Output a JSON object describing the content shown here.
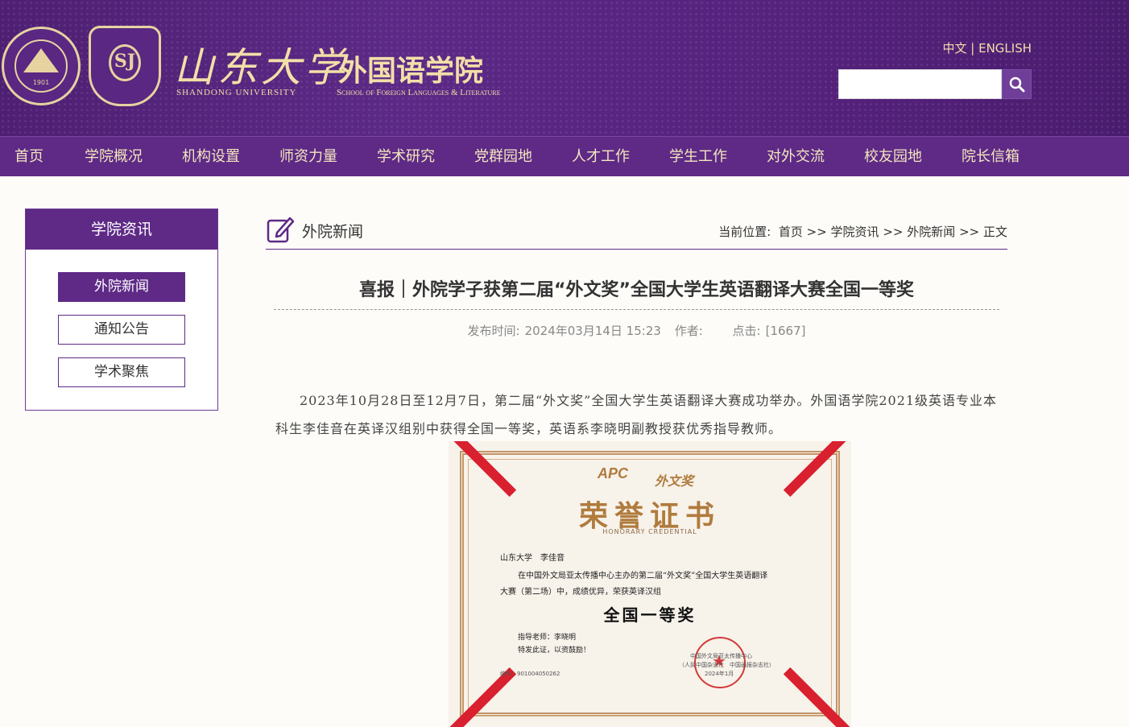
{
  "header": {
    "university_cn": "山东大学",
    "university_en": "SHANDONG UNIVERSITY",
    "school_cn": "外国语学院",
    "school_en": "School of Foreign Languages & Literature",
    "logo1_year": "1901",
    "logo2_text": "SJ",
    "lang_cn": "中文",
    "lang_sep": " | ",
    "lang_en": "ENGLISH",
    "search_placeholder": "",
    "search_icon": "search-icon",
    "accent_color": "#5e2a86",
    "gold_color": "#f2dfa8"
  },
  "nav": {
    "items": [
      "首页",
      "学院概况",
      "机构设置",
      "师资力量",
      "学术研究",
      "党群园地",
      "人才工作",
      "学生工作",
      "对外交流",
      "校友园地",
      "院长信箱"
    ]
  },
  "sidebar": {
    "title": "学院资讯",
    "items": [
      "外院新闻",
      "通知公告",
      "学术聚焦"
    ],
    "active_index": 0
  },
  "main": {
    "section_title": "外院新闻",
    "section_icon": "edit-icon",
    "crumb_prefix": "当前位置:",
    "crumbs": [
      "首页",
      "学院资讯",
      "外院新闻",
      "正文"
    ],
    "crumb_sep": ">>",
    "article_title": "喜报｜外院学子获第二届“外文奖”全国大学生英语翻译大赛全国一等奖",
    "publish_label": "发布时间:",
    "publish_time": "2024年03月14日 15:23",
    "author_label": "作者:",
    "author": "",
    "clicks_label": "点击:",
    "clicks": "[1667]",
    "paragraph": "2023年10月28日至12月7日，第二届“外文奖”全国大学生英语翻译大赛成功举办。外国语学院2021级英语专业本科生李佳音在英译汉组别中获得全国一等奖，英语系李晓明副教授获优秀指导教师。"
  },
  "certificate": {
    "apc": "APC",
    "brand": "外文奖",
    "title": "荣誉证书",
    "title_en": "HONORARY CREDENTIAL",
    "recipient": "山东大学　李佳音",
    "body1": "在中国外文局亚太传播中心主办的第二届“外文奖”全国大学生英语翻译",
    "body2": "大赛（第二场）中，成绩优异，荣获英译汉组",
    "award": "全国一等奖",
    "teacher": "指导老师：李晓明",
    "special": "特发此证，以资鼓励！",
    "number": "编号：901004050262",
    "issuer": "中国外文局亚太传播中心",
    "issuer2": "（人民中国杂志社　中国画报杂志社）",
    "date": "2024年1月"
  }
}
